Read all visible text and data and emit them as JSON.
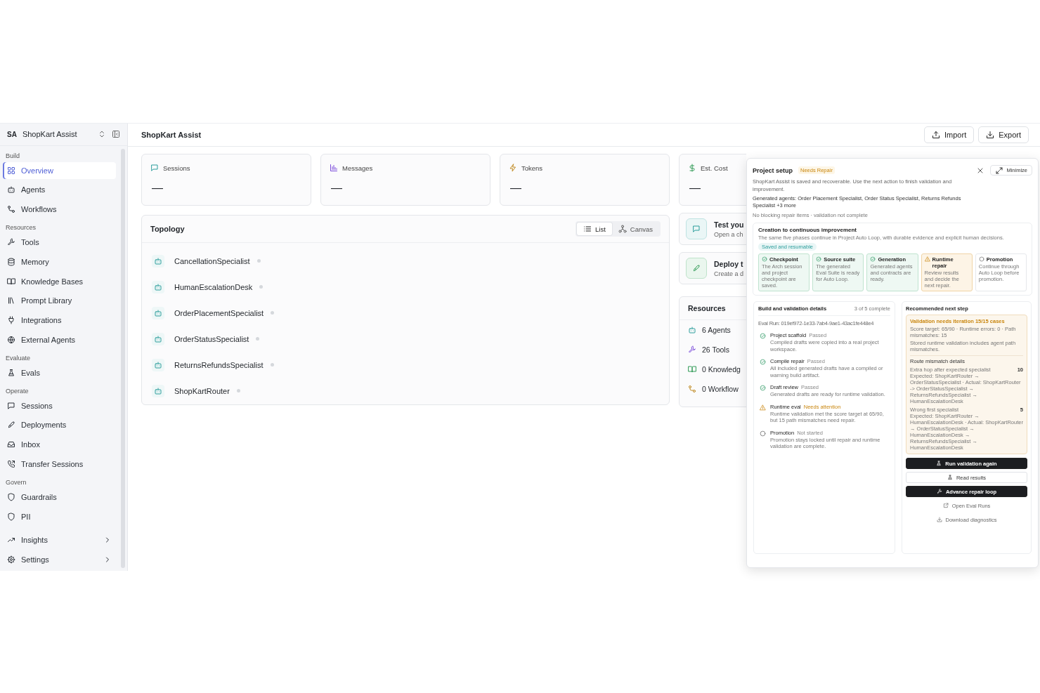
{
  "sidebar": {
    "workspace": {
      "initials": "SA",
      "name": "ShopKart Assist"
    },
    "sections": [
      {
        "label": "Build",
        "items": [
          {
            "label": "Overview",
            "selected": true,
            "expandable": false
          },
          {
            "label": "Agents",
            "selected": false,
            "expandable": false
          },
          {
            "label": "Workflows",
            "selected": false,
            "expandable": false
          }
        ]
      },
      {
        "label": "Resources",
        "items": [
          {
            "label": "Tools",
            "selected": false,
            "expandable": false
          },
          {
            "label": "Memory",
            "selected": false,
            "expandable": false
          },
          {
            "label": "Knowledge Bases",
            "selected": false,
            "expandable": false
          },
          {
            "label": "Prompt Library",
            "selected": false,
            "expandable": false
          },
          {
            "label": "Integrations",
            "selected": false,
            "expandable": false
          },
          {
            "label": "External Agents",
            "selected": false,
            "expandable": false
          }
        ]
      },
      {
        "label": "Evaluate",
        "items": [
          {
            "label": "Evals",
            "selected": false,
            "expandable": false
          }
        ]
      },
      {
        "label": "Operate",
        "items": [
          {
            "label": "Sessions",
            "selected": false,
            "expandable": false
          },
          {
            "label": "Deployments",
            "selected": false,
            "expandable": false
          },
          {
            "label": "Inbox",
            "selected": false,
            "expandable": false
          },
          {
            "label": "Transfer Sessions",
            "selected": false,
            "expandable": false
          }
        ]
      },
      {
        "label": "Govern",
        "items": [
          {
            "label": "Guardrails",
            "selected": false,
            "expandable": false
          },
          {
            "label": "PII",
            "selected": false,
            "expandable": false
          }
        ]
      },
      {
        "items": [
          {
            "label": "Insights",
            "selected": false,
            "expandable": true
          },
          {
            "label": "Settings",
            "selected": false,
            "expandable": true
          }
        ]
      }
    ]
  },
  "header": {
    "title": "ShopKart Assist",
    "buttons": [
      "Import",
      "Export"
    ]
  },
  "stats": [
    {
      "label": "Sessions",
      "value": "—"
    },
    {
      "label": "Messages",
      "value": "—"
    },
    {
      "label": "Tokens",
      "value": "—"
    },
    {
      "label": "Est. Cost",
      "value": "—"
    }
  ],
  "topology": {
    "title": "Topology",
    "views": [
      {
        "label": "List",
        "selected": true
      },
      {
        "label": "Canvas",
        "selected": false
      }
    ],
    "agents": [
      "CancellationSpecialist",
      "HumanEscalationDesk",
      "OrderPlacementSpecialist",
      "OrderStatusSpecialist",
      "ReturnsRefundsSpecialist",
      "ShopKartRouter"
    ]
  },
  "actions": [
    {
      "title": "Test you",
      "subtitle": "Open a ch"
    },
    {
      "title": "Deploy t",
      "subtitle": "Create a d"
    }
  ],
  "resources": {
    "title": "Resources",
    "items": [
      "6 Agents",
      "26 Tools",
      "0 Knowledg",
      "0 Workflow"
    ]
  },
  "project_setup": {
    "title": "Project setup",
    "badge": "Needs Repair",
    "minimize": "Minimize",
    "description": "ShopKart Assist is saved and recoverable. Use the next action to finish validation and improvement.",
    "generated": "Generated agents: Order Placement Specialist, Order Status Specialist, Returns Refunds Specialist +3 more",
    "note": "No blocking repair items · validation not complete",
    "improvement": {
      "title": "Creation to continuous improvement",
      "subtitle": "The same five phases continue in Project Auto Loop, with durable evidence and explicit human decisions.",
      "chip": "Saved and resumable",
      "phases": [
        {
          "title": "Checkpoint",
          "text": "The Arch session and project checkpoint are saved.",
          "kind": "done"
        },
        {
          "title": "Source suite",
          "text": "The generated Eval Suite is ready for Auto Loop.",
          "kind": "done"
        },
        {
          "title": "Generation",
          "text": "Generated agents and contracts are ready.",
          "kind": "done"
        },
        {
          "title": "Runtime repair",
          "text": "Review results and decide the next repair.",
          "kind": "warning"
        },
        {
          "title": "Promotion",
          "text": "Continue through Auto Loop before promotion.",
          "kind": "pending"
        }
      ]
    },
    "details": {
      "title": "Build and validation details",
      "count": "3 of 5 complete",
      "eval_run": "Eval Run: 019ef972-1e33-7ab4-9ae1-43ac1fe448e4",
      "steps": [
        {
          "title": "Project scaffold",
          "status_label": "Passed",
          "kind": "done",
          "text": "Compiled drafts were copied into a real project workspace."
        },
        {
          "title": "Compile repair",
          "status_label": "Passed",
          "kind": "done",
          "text": "All included generated drafts have a compiled or warning build artifact."
        },
        {
          "title": "Draft review",
          "status_label": "Passed",
          "kind": "done",
          "text": "Generated drafts are ready for runtime validation."
        },
        {
          "title": "Runtime eval",
          "status_label": "Needs attention",
          "kind": "warning",
          "text": "Runtime validation met the score target at 65/90, but 15 path mismatches need repair."
        },
        {
          "title": "Promotion",
          "status_label": "Not started",
          "kind": "pending",
          "text": "Promotion stays locked until repair and runtime validation are complete."
        }
      ]
    },
    "next_step": {
      "title": "Recommended next step",
      "alert_title": "Validation needs iteration 15/15 cases",
      "alert_lines": [
        "Score target: 65/90 · Runtime errors: 0 · Path mismatches: 15",
        "Stored runtime validation includes agent path mismatches."
      ],
      "mismatch_title": "Route mismatch details",
      "mismatches": [
        {
          "label": "Extra hop after expected specialist",
          "count": "10",
          "detail": "Expected: ShopKartRouter → OrderStatusSpecialist · Actual: ShopKartRouter -> OrderStatusSpecialist → ReturnsRefundsSpecialist → HumanEscalationDesk"
        },
        {
          "label": "Wrong first specialist",
          "count": "5",
          "detail": "Expected: ShopKartRouter → HumanEscalationDesk · Actual: ShopKartRouter → OrderStatusSpecialist → HumanEscalationDesk → ReturnsRefundsSpecialist → HumanEscalationDesk"
        }
      ],
      "buttons": [
        {
          "label": "Run validation again",
          "kind": "primary"
        },
        {
          "label": "Read results",
          "kind": "secondary"
        },
        {
          "label": "Advance repair loop",
          "kind": "primary"
        },
        {
          "label": "Open Eval Runs",
          "kind": "link"
        },
        {
          "label": "Download diagnostics",
          "kind": "link"
        }
      ]
    }
  }
}
